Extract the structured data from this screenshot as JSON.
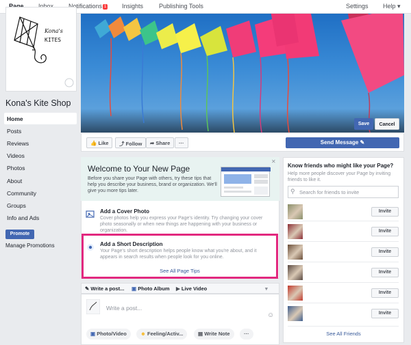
{
  "topnav": {
    "page": "Page",
    "inbox": "Inbox",
    "notifications": "Notifications",
    "notif_count": "1",
    "insights": "Insights",
    "publishing_tools": "Publishing Tools",
    "settings": "Settings",
    "help": "Help ▾"
  },
  "sidebar": {
    "logo_text_1": "Kona's",
    "logo_text_2": "KITES",
    "page_name": "Kona's Kite Shop",
    "items": [
      {
        "label": "Home"
      },
      {
        "label": "Posts"
      },
      {
        "label": "Reviews"
      },
      {
        "label": "Videos"
      },
      {
        "label": "Photos"
      },
      {
        "label": "About"
      },
      {
        "label": "Community"
      },
      {
        "label": "Groups"
      },
      {
        "label": "Info and Ads"
      }
    ],
    "promote": "Promote",
    "manage_promotions": "Manage Promotions"
  },
  "cover": {
    "save": "Save",
    "cancel": "Cancel"
  },
  "actions": {
    "like": "Like",
    "follow": "Follow",
    "share": "Share",
    "more": "···",
    "send_message": "Send Message"
  },
  "tips": {
    "title": "Welcome to Your New Page",
    "body": "Before you share your Page with others, try these tips that help you describe your business, brand or organization. We'll give you more tips later.",
    "close": "✕",
    "cover_title": "Add a Cover Photo",
    "cover_body": "Cover photos help you express your Page's identity. Try changing your cover photo seasonally or when new things are happening with your business or organization.",
    "desc_title": "Add a Short Description",
    "desc_body": "Your Page's short description helps people know what you're about, and it appears in search results when people look for you online.",
    "see_all": "See All Page Tips"
  },
  "composer": {
    "tab_write": "Write a post...",
    "tab_album": "Photo Album",
    "tab_live": "Live Video",
    "placeholder": "Write a post...",
    "photo_video": "Photo/Video",
    "feeling": "Feeling/Activ...",
    "write_note": "Write Note",
    "more": "···"
  },
  "friends": {
    "title": "Know friends who might like your Page?",
    "subtitle": "Help more people discover your Page by inviting friends to like it.",
    "search_placeholder": "Search for friends to invite",
    "invite": "Invite",
    "see_all": "See All Friends",
    "photo_colors": [
      "#8a8f6a",
      "#8c2f36",
      "#6b4f3a",
      "#5a4a42",
      "#c23b2e",
      "#3f5f8f"
    ]
  }
}
